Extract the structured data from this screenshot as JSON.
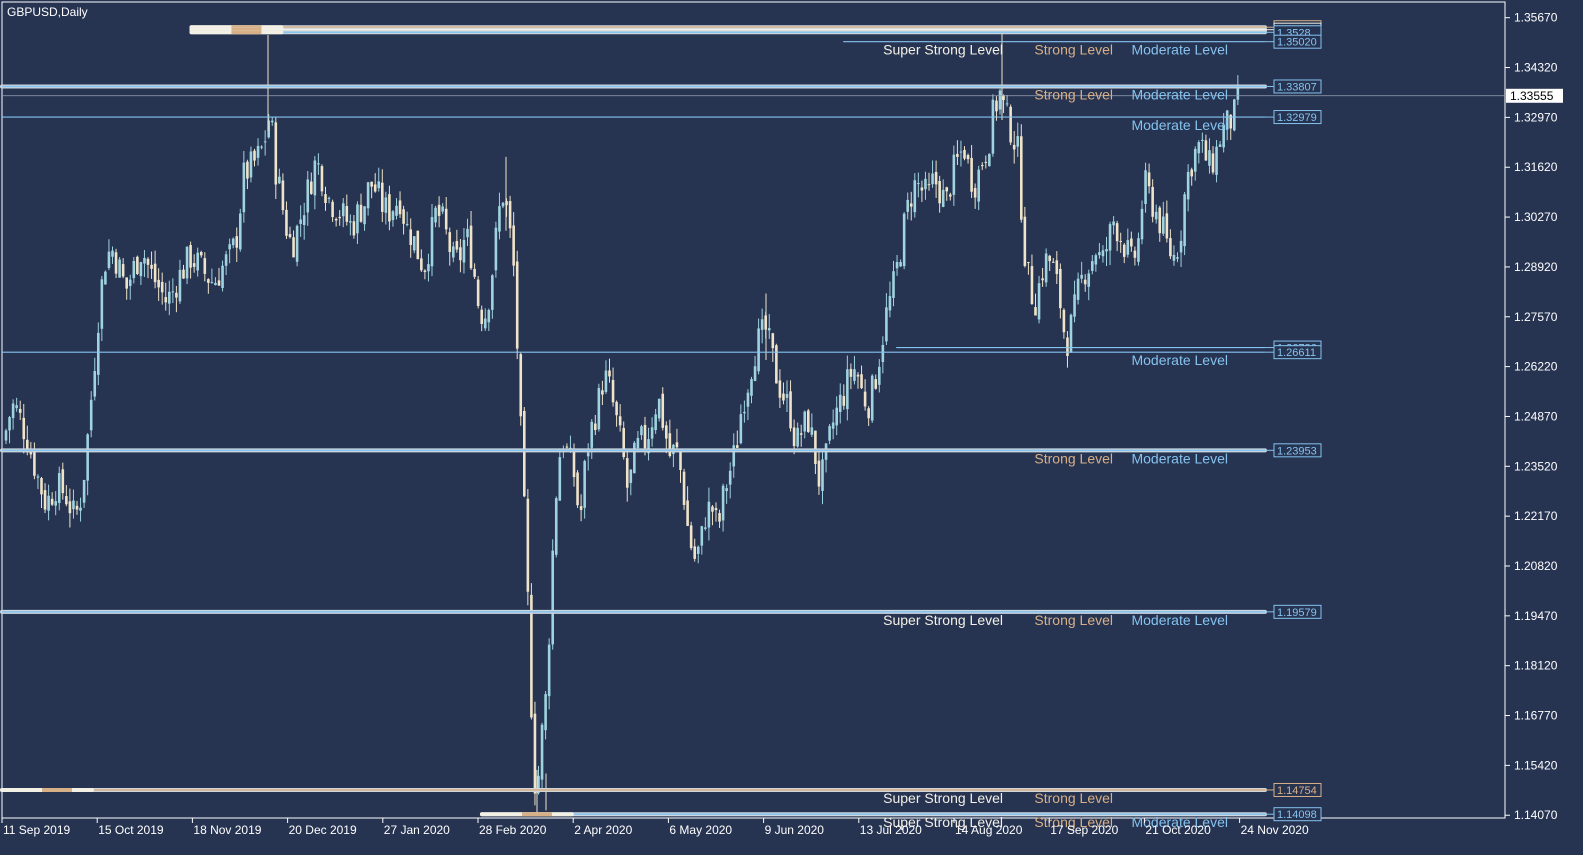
{
  "window": {
    "title": "GBPUSD,Daily"
  },
  "colors": {
    "background": "#263351",
    "frame": "#ffffff",
    "candle_up": "#9fd3df",
    "candle_down": "#efe3c9",
    "moderate": "#86c3ee",
    "strong": "#d8b087",
    "super_strong": "#f3f0e6",
    "price_line": "#9aa4b7"
  },
  "chart_data": {
    "type": "candlestick",
    "title": "GBPUSD,Daily",
    "ylim": [
      1.13995,
      1.36095
    ],
    "yticks": [
      "1.35670",
      "1.34320",
      "1.32970",
      "1.31620",
      "1.30270",
      "1.28920",
      "1.27570",
      "1.26220",
      "1.24870",
      "1.23520",
      "1.22170",
      "1.20820",
      "1.19470",
      "1.18120",
      "1.16770",
      "1.15420",
      "1.14070"
    ],
    "xticks": [
      "11 Sep 2019",
      "15 Oct 2019",
      "18 Nov 2019",
      "20 Dec 2019",
      "27 Jan 2020",
      "28 Feb 2020",
      "2 Apr 2020",
      "6 May 2020",
      "9 Jun 2020",
      "13 Jul 2020",
      "14 Aug 2020",
      "17 Sep 2020",
      "21 Oct 2020",
      "24 Nov 2020"
    ],
    "current_price": "1.33555",
    "close_path": [
      [
        0,
        1.236
      ],
      [
        8,
        1.248
      ],
      [
        14,
        1.252
      ],
      [
        22,
        1.247
      ],
      [
        30,
        1.24
      ],
      [
        38,
        1.232
      ],
      [
        46,
        1.225
      ],
      [
        56,
        1.23
      ],
      [
        65,
        1.228
      ],
      [
        75,
        1.221
      ],
      [
        82,
        1.228
      ],
      [
        88,
        1.244
      ],
      [
        94,
        1.262
      ],
      [
        100,
        1.281
      ],
      [
        106,
        1.292
      ],
      [
        112,
        1.294
      ],
      [
        118,
        1.29
      ],
      [
        126,
        1.283
      ],
      [
        134,
        1.289
      ],
      [
        142,
        1.294
      ],
      [
        150,
        1.288
      ],
      [
        158,
        1.284
      ],
      [
        166,
        1.28
      ],
      [
        172,
        1.282
      ],
      [
        178,
        1.286
      ],
      [
        184,
        1.289
      ],
      [
        190,
        1.292
      ],
      [
        198,
        1.29
      ],
      [
        206,
        1.287
      ],
      [
        214,
        1.285
      ],
      [
        222,
        1.289
      ],
      [
        230,
        1.292
      ],
      [
        236,
        1.296
      ],
      [
        240,
        1.305
      ],
      [
        244,
        1.314
      ],
      [
        250,
        1.316
      ],
      [
        256,
        1.318
      ],
      [
        260,
        1.32
      ],
      [
        264,
        1.322
      ],
      [
        268,
        1.33
      ],
      [
        272,
        1.326
      ],
      [
        276,
        1.315
      ],
      [
        280,
        1.31
      ],
      [
        284,
        1.303
      ],
      [
        288,
        1.298
      ],
      [
        292,
        1.295
      ],
      [
        298,
        1.3
      ],
      [
        304,
        1.306
      ],
      [
        310,
        1.312
      ],
      [
        316,
        1.318
      ],
      [
        322,
        1.314
      ],
      [
        328,
        1.308
      ],
      [
        334,
        1.306
      ],
      [
        340,
        1.304
      ],
      [
        346,
        1.302
      ],
      [
        352,
        1.3
      ],
      [
        358,
        1.304
      ],
      [
        364,
        1.306
      ],
      [
        370,
        1.312
      ],
      [
        376,
        1.31
      ],
      [
        382,
        1.306
      ],
      [
        388,
        1.304
      ],
      [
        394,
        1.306
      ],
      [
        400,
        1.308
      ],
      [
        406,
        1.3
      ],
      [
        412,
        1.298
      ],
      [
        418,
        1.293
      ],
      [
        424,
        1.289
      ],
      [
        430,
        1.296
      ],
      [
        436,
        1.304
      ],
      [
        442,
        1.302
      ],
      [
        448,
        1.296
      ],
      [
        454,
        1.29
      ],
      [
        460,
        1.292
      ],
      [
        466,
        1.298
      ],
      [
        472,
        1.292
      ],
      [
        478,
        1.28
      ],
      [
        484,
        1.275
      ],
      [
        490,
        1.283
      ],
      [
        496,
        1.297
      ],
      [
        502,
        1.31
      ],
      [
        508,
        1.303
      ],
      [
        514,
        1.288
      ],
      [
        518,
        1.263
      ],
      [
        522,
        1.236
      ],
      [
        526,
        1.213
      ],
      [
        530,
        1.182
      ],
      [
        534,
        1.15
      ],
      [
        538,
        1.15
      ],
      [
        542,
        1.163
      ],
      [
        546,
        1.173
      ],
      [
        550,
        1.195
      ],
      [
        554,
        1.22
      ],
      [
        558,
        1.235
      ],
      [
        562,
        1.243
      ],
      [
        568,
        1.238
      ],
      [
        574,
        1.233
      ],
      [
        580,
        1.22
      ],
      [
        586,
        1.238
      ],
      [
        592,
        1.246
      ],
      [
        598,
        1.252
      ],
      [
        604,
        1.26
      ],
      [
        610,
        1.256
      ],
      [
        616,
        1.248
      ],
      [
        622,
        1.24
      ],
      [
        628,
        1.228
      ],
      [
        634,
        1.237
      ],
      [
        640,
        1.242
      ],
      [
        646,
        1.242
      ],
      [
        652,
        1.248
      ],
      [
        658,
        1.254
      ],
      [
        664,
        1.246
      ],
      [
        670,
        1.238
      ],
      [
        676,
        1.24
      ],
      [
        682,
        1.232
      ],
      [
        688,
        1.218
      ],
      [
        694,
        1.21
      ],
      [
        700,
        1.213
      ],
      [
        706,
        1.223
      ],
      [
        712,
        1.224
      ],
      [
        718,
        1.218
      ],
      [
        724,
        1.228
      ],
      [
        730,
        1.234
      ],
      [
        736,
        1.24
      ],
      [
        742,
        1.252
      ],
      [
        748,
        1.258
      ],
      [
        754,
        1.266
      ],
      [
        760,
        1.27
      ],
      [
        766,
        1.272
      ],
      [
        772,
        1.265
      ],
      [
        778,
        1.258
      ],
      [
        784,
        1.254
      ],
      [
        790,
        1.25
      ],
      [
        796,
        1.241
      ],
      [
        802,
        1.245
      ],
      [
        808,
        1.248
      ],
      [
        814,
        1.24
      ],
      [
        820,
        1.23
      ],
      [
        826,
        1.237
      ],
      [
        832,
        1.246
      ],
      [
        838,
        1.251
      ],
      [
        844,
        1.255
      ],
      [
        850,
        1.26
      ],
      [
        856,
        1.262
      ],
      [
        862,
        1.255
      ],
      [
        868,
        1.252
      ],
      [
        874,
        1.257
      ],
      [
        880,
        1.266
      ],
      [
        886,
        1.276
      ],
      [
        892,
        1.282
      ],
      [
        898,
        1.29
      ],
      [
        904,
        1.3
      ],
      [
        910,
        1.308
      ],
      [
        916,
        1.312
      ],
      [
        922,
        1.31
      ],
      [
        928,
        1.308
      ],
      [
        934,
        1.313
      ],
      [
        940,
        1.31
      ],
      [
        946,
        1.306
      ],
      [
        952,
        1.314
      ],
      [
        958,
        1.318
      ],
      [
        964,
        1.322
      ],
      [
        970,
        1.314
      ],
      [
        976,
        1.312
      ],
      [
        982,
        1.318
      ],
      [
        988,
        1.322
      ],
      [
        994,
        1.332
      ],
      [
        1000,
        1.336
      ],
      [
        1006,
        1.33
      ],
      [
        1012,
        1.326
      ],
      [
        1018,
        1.32
      ],
      [
        1024,
        1.295
      ],
      [
        1030,
        1.283
      ],
      [
        1036,
        1.28
      ],
      [
        1042,
        1.288
      ],
      [
        1048,
        1.292
      ],
      [
        1054,
        1.288
      ],
      [
        1060,
        1.28
      ],
      [
        1066,
        1.268
      ],
      [
        1072,
        1.274
      ],
      [
        1078,
        1.282
      ],
      [
        1084,
        1.288
      ],
      [
        1090,
        1.29
      ],
      [
        1096,
        1.294
      ],
      [
        1102,
        1.29
      ],
      [
        1108,
        1.296
      ],
      [
        1114,
        1.302
      ],
      [
        1120,
        1.298
      ],
      [
        1126,
        1.294
      ],
      [
        1132,
        1.29
      ],
      [
        1138,
        1.295
      ],
      [
        1144,
        1.312
      ],
      [
        1150,
        1.308
      ],
      [
        1156,
        1.304
      ],
      [
        1162,
        1.3
      ],
      [
        1168,
        1.294
      ],
      [
        1174,
        1.292
      ],
      [
        1180,
        1.297
      ],
      [
        1186,
        1.312
      ],
      [
        1192,
        1.318
      ],
      [
        1198,
        1.322
      ],
      [
        1204,
        1.32
      ],
      [
        1210,
        1.316
      ],
      [
        1216,
        1.32
      ],
      [
        1222,
        1.326
      ],
      [
        1228,
        1.328
      ],
      [
        1234,
        1.33
      ],
      [
        1240,
        1.336
      ]
    ],
    "levels": [
      {
        "price": 1.35412,
        "label": "1.3541",
        "kind": "strong",
        "box": true,
        "line_start": 0.15
      },
      {
        "price": 1.35345,
        "label": "1.3534",
        "kind": "super_strong",
        "box": true,
        "line_start": 0.15
      },
      {
        "price": 1.35275,
        "label": "1.3528",
        "kind": "moderate",
        "box": true,
        "line_start": 0.15
      },
      {
        "price": 1.3502,
        "label": "1.35020",
        "kind": "moderate",
        "box": true,
        "line_start": 0.666
      },
      {
        "price": 1.33807,
        "label": "1.33807",
        "kind": "moderate",
        "box": true,
        "line_start": 0
      },
      {
        "price": 1.32979,
        "label": "1.32979",
        "kind": "moderate",
        "box": true,
        "line_start": 0
      },
      {
        "price": 1.26736,
        "label": "1.26736",
        "kind": "moderate",
        "box": true,
        "line_start": 0.708
      },
      {
        "price": 1.26611,
        "label": "1.26611",
        "kind": "moderate",
        "box": true,
        "line_start": 0
      },
      {
        "price": 1.23953,
        "label": "1.23953",
        "kind": "moderate",
        "box": true,
        "line_start": 0
      },
      {
        "price": 1.19579,
        "label": "1.19579",
        "kind": "moderate",
        "box": true,
        "line_start": 0
      },
      {
        "price": 1.14754,
        "label": "1.14754",
        "kind": "strong",
        "box": true,
        "line_start": 0
      },
      {
        "price": 1.14098,
        "label": "1.14098",
        "kind": "moderate",
        "box": true,
        "line_start": 0.38
      }
    ],
    "level_texts": [
      {
        "price": 1.3502,
        "super": "Super Strong Level",
        "strong": "Strong Level",
        "moderate": "Moderate Level"
      },
      {
        "price": 1.33807,
        "super": "",
        "strong": "Strong Level",
        "moderate": "Moderate Level"
      },
      {
        "price": 1.32979,
        "super": "",
        "strong": "",
        "moderate": "Moderate Level"
      },
      {
        "price": 1.26611,
        "super": "",
        "strong": "",
        "moderate": "Moderate Level"
      },
      {
        "price": 1.23953,
        "super": "",
        "strong": "Strong Level",
        "moderate": "Moderate Level"
      },
      {
        "price": 1.19579,
        "super": "Super Strong Level",
        "strong": "Strong Level",
        "moderate": "Moderate Level"
      },
      {
        "price": 1.14754,
        "super": "Super Strong Level",
        "strong": "Strong Level",
        "moderate": ""
      },
      {
        "price": 1.14098,
        "super": "Super Strong Level",
        "strong": "Strong Level",
        "moderate": "Moderate Level"
      }
    ],
    "grid": false,
    "legend": "none"
  }
}
